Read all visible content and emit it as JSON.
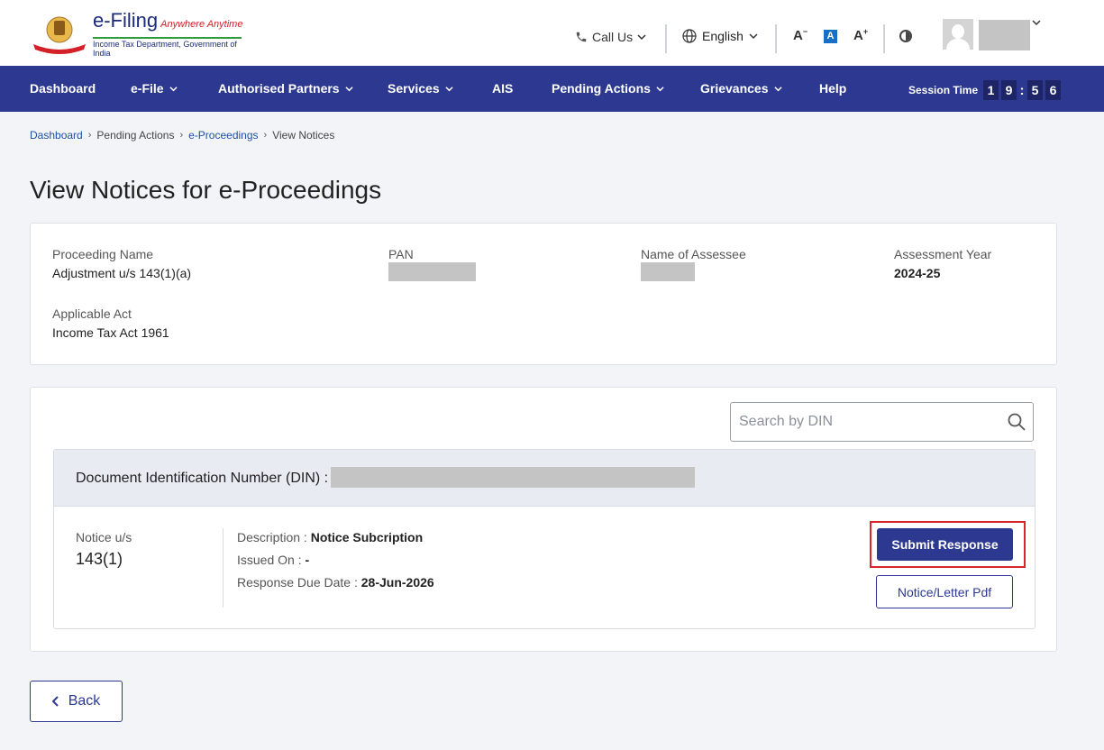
{
  "header": {
    "logo": {
      "title": "e-Filing",
      "tagline": "Anywhere Anytime",
      "subtitle": "Income Tax Department, Government of India"
    },
    "call_us": "Call Us",
    "language": "English",
    "font_decrease": "A",
    "font_reset": "A",
    "font_increase": "A",
    "icons": [
      "phone-icon",
      "globe-icon",
      "contrast-icon",
      "avatar-icon"
    ]
  },
  "nav": {
    "items": [
      {
        "label": "Dashboard",
        "has_dropdown": false
      },
      {
        "label": "e-File",
        "has_dropdown": true
      },
      {
        "label": "Authorised Partners",
        "has_dropdown": true
      },
      {
        "label": "Services",
        "has_dropdown": true
      },
      {
        "label": "AIS",
        "has_dropdown": false
      },
      {
        "label": "Pending Actions",
        "has_dropdown": true
      },
      {
        "label": "Grievances",
        "has_dropdown": true
      },
      {
        "label": "Help",
        "has_dropdown": false
      }
    ],
    "session_label": "Session Time",
    "session_digits": [
      "1",
      "9",
      "5",
      "6"
    ]
  },
  "breadcrumb": [
    {
      "label": "Dashboard",
      "link": true
    },
    {
      "label": "Pending Actions",
      "link": false
    },
    {
      "label": "e-Proceedings",
      "link": true
    },
    {
      "label": "View Notices",
      "link": false
    }
  ],
  "page_title": "View Notices for e-Proceedings",
  "proceeding": {
    "name_label": "Proceeding Name",
    "name_value": "Adjustment u/s 143(1)(a)",
    "pan_label": "PAN",
    "assessee_label": "Name of Assessee",
    "ay_label": "Assessment Year",
    "ay_value": "2024-25",
    "act_label": "Applicable Act",
    "act_value": "Income Tax Act 1961"
  },
  "search": {
    "placeholder": "Search by DIN"
  },
  "notice": {
    "din_label": "Document Identification Number (DIN) :",
    "section_label": "Notice u/s",
    "section_value": "143(1)",
    "description_label": "Description :",
    "description_value": "Notice Subcription",
    "issued_label": "Issued On :",
    "issued_value": "-",
    "due_label": "Response Due Date :",
    "due_value": "28-Jun-2026",
    "submit_label": "Submit Response",
    "pdf_label": "Notice/Letter Pdf"
  },
  "back_label": "Back",
  "colors": {
    "primary": "#2d3990",
    "highlight": "#d9232d",
    "link": "#1c50a8"
  }
}
